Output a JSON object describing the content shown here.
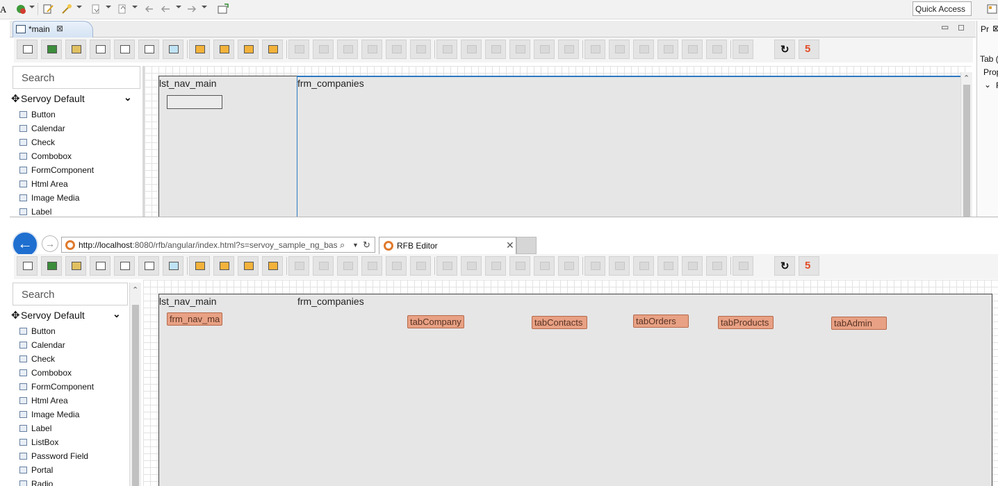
{
  "top_toolbar": {
    "quick_access_label": "Quick Access"
  },
  "editor": {
    "tab_label": "*main",
    "tab_close": "⊠",
    "minimize": "▭",
    "maximize": "◻"
  },
  "right_panel": {
    "tab_label": "Pr",
    "close": "⊠",
    "tab_item": "Tab (",
    "prop_item": "Prop",
    "collapse": "⌄",
    "r": "F"
  },
  "palette_top": {
    "search_placeholder": "Search",
    "group_name": "Servoy Default",
    "items": [
      {
        "label": "Button",
        "icon": "button-icon"
      },
      {
        "label": "Calendar",
        "icon": "calendar-icon"
      },
      {
        "label": "Check",
        "icon": "check-icon"
      },
      {
        "label": "Combobox",
        "icon": "combobox-icon"
      },
      {
        "label": "FormComponent",
        "icon": "formcomponent-icon"
      },
      {
        "label": "Html Area",
        "icon": "html-area-icon"
      },
      {
        "label": "Image Media",
        "icon": "image-media-icon"
      },
      {
        "label": "Label",
        "icon": "label-icon"
      }
    ]
  },
  "palette_bottom": {
    "search_placeholder": "Search",
    "group_name": "Servoy Default",
    "items": [
      {
        "label": "Button",
        "icon": "button-icon"
      },
      {
        "label": "Calendar",
        "icon": "calendar-icon"
      },
      {
        "label": "Check",
        "icon": "check-icon"
      },
      {
        "label": "Combobox",
        "icon": "combobox-icon"
      },
      {
        "label": "FormComponent",
        "icon": "formcomponent-icon"
      },
      {
        "label": "Html Area",
        "icon": "html-area-icon"
      },
      {
        "label": "Image Media",
        "icon": "image-media-icon"
      },
      {
        "label": "Label",
        "icon": "label-icon"
      },
      {
        "label": "ListBox",
        "icon": "listbox-icon"
      },
      {
        "label": "Password Field",
        "icon": "password-field-icon"
      },
      {
        "label": "Portal",
        "icon": "portal-icon"
      },
      {
        "label": "Radio",
        "icon": "radio-icon"
      }
    ]
  },
  "form_top": {
    "nav_label": "lst_nav_main",
    "content_label": "frm_companies"
  },
  "browser": {
    "url_host": "http://localhost",
    "url_rest": ":8080/rfb/angular/index.html?s=servoy_sample_ng_bas",
    "tab_title": "RFB Editor",
    "tab_close": "✕"
  },
  "form_bottom": {
    "nav_label": "lst_nav_main",
    "content_label": "frm_companies",
    "nav_component": "frm_nav_ma",
    "tabs": [
      "tabCompany",
      "tabContacts",
      "tabOrders",
      "tabProducts",
      "tabAdmin"
    ]
  },
  "colors": {
    "tab_component": "#e8a184",
    "browser_back": "#1f6fd0",
    "selection_blue": "#2b79c2"
  }
}
